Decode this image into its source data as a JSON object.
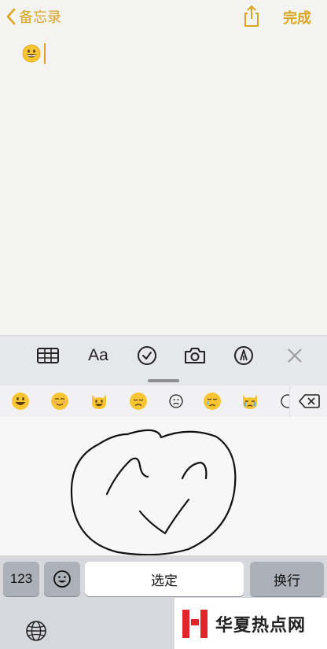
{
  "nav": {
    "back_label": "备忘录",
    "done_label": "完成",
    "accent_color": "#d9a520"
  },
  "note": {
    "content": "😀"
  },
  "toolbar": {
    "items": [
      "table-icon",
      "format-icon",
      "checklist-icon",
      "camera-icon",
      "markup-icon",
      "close-icon"
    ],
    "format_label": "Aa"
  },
  "emoji_bar": {
    "items": [
      "grinning-face",
      "smiling-face",
      "grinning-cat",
      "disappointed-face",
      "frowning-face",
      "crying-face",
      "crying-cat"
    ]
  },
  "keyboard": {
    "numbers_label": "123",
    "select_label": "选定",
    "return_label": "换行",
    "globe_icon": "globe-icon",
    "emoji_icon": "emoji-icon"
  },
  "watermark": {
    "text": "华夏热点网"
  }
}
